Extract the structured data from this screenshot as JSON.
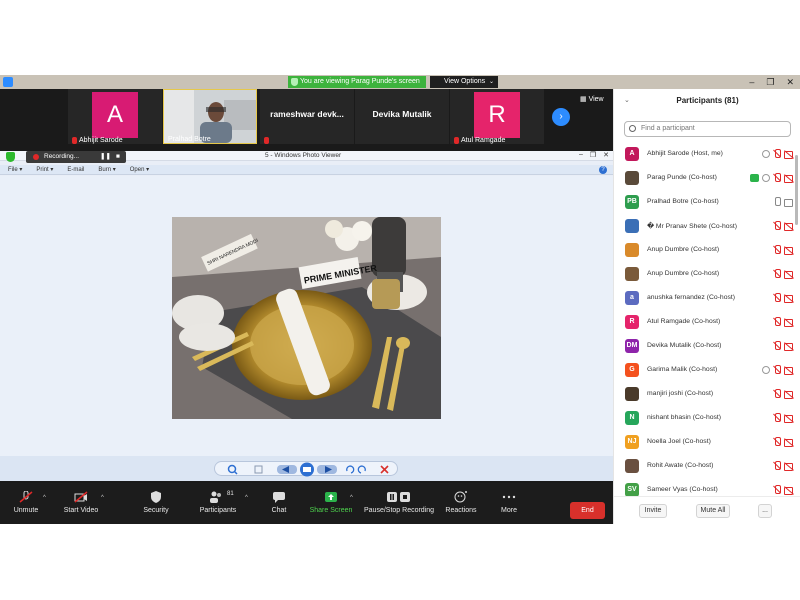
{
  "banner": {
    "viewing": "You are viewing Parag Punde's screen",
    "view_options": "View Options"
  },
  "window_controls": [
    "–",
    "❐",
    "✕"
  ],
  "video_strip": {
    "tiles": [
      {
        "kind": "avatar",
        "initial": "A",
        "color": "#d81b73",
        "name": "Abhijit Sarode",
        "muted": true
      },
      {
        "kind": "video",
        "name": "Pralhad Botre",
        "muted": false
      },
      {
        "kind": "text",
        "big": "rameshwar  devk...",
        "muted": true
      },
      {
        "kind": "text",
        "big": "Devika Mutalik",
        "muted": false
      },
      {
        "kind": "avatar",
        "initial": "R",
        "color": "#e5246b",
        "name": "Atul Ramgade",
        "muted": true
      }
    ],
    "view_label": "View"
  },
  "recording": {
    "label": "Recording...",
    "pause": "❚❚",
    "stop": "■"
  },
  "photo_viewer": {
    "title": "5 - Windows Photo Viewer",
    "menu": [
      "File ▾",
      "Print ▾",
      "E-mail",
      "Burn ▾",
      "Open ▾"
    ],
    "help": "?",
    "photo_card": "PRIME MINISTER",
    "name_card": "SHRI NARENDRA MODI"
  },
  "toolbar": {
    "unmute": "Unmute",
    "start_video": "Start Video",
    "security": "Security",
    "participants": "Participants",
    "participants_count": "81",
    "chat": "Chat",
    "share_screen": "Share Screen",
    "pause_recording": "Pause/Stop Recording",
    "reactions": "Reactions",
    "more": "More",
    "end": "End"
  },
  "panel": {
    "title": "Participants (81)",
    "search_placeholder": "Find a participant",
    "participants": [
      {
        "initials": "A",
        "color": "#c2185b",
        "name": "Abhijit Sarode (Host, me)",
        "icons": [
          "rec",
          "mic-off",
          "cam-off"
        ]
      },
      {
        "initials": "",
        "color": "#5a4a3a",
        "name": "Parag Punde (Co-host)",
        "icons": [
          "share",
          "rec",
          "mic-off",
          "cam-off"
        ]
      },
      {
        "initials": "PB",
        "color": "#2e9d4e",
        "name": "Pralhad Botre (Co-host)",
        "icons": [
          "mic",
          "cam"
        ]
      },
      {
        "initials": "",
        "color": "#3b6fb6",
        "name": "� Mr Pranav Shete (Co-host)",
        "icons": [
          "mic-off",
          "cam-off"
        ]
      },
      {
        "initials": "",
        "color": "#d98a2b",
        "name": "Anup Dumbre (Co-host)",
        "icons": [
          "mic-off",
          "cam-off"
        ]
      },
      {
        "initials": "",
        "color": "#7a5a3a",
        "name": "Anup Dumbre (Co-host)",
        "icons": [
          "mic-off",
          "cam-off"
        ]
      },
      {
        "initials": "a",
        "color": "#5c6bc0",
        "name": "anushka fernandez (Co-host)",
        "icons": [
          "mic-off",
          "cam-off"
        ]
      },
      {
        "initials": "R",
        "color": "#e5246b",
        "name": "Atul Ramgade (Co-host)",
        "icons": [
          "mic-off",
          "cam-off"
        ]
      },
      {
        "initials": "DM",
        "color": "#8e24aa",
        "name": "Devika Mutalik (Co-host)",
        "icons": [
          "mic-off",
          "cam-off"
        ]
      },
      {
        "initials": "G",
        "color": "#f4511e",
        "name": "Garima Malik (Co-host)",
        "icons": [
          "rec",
          "mic-off",
          "cam-off"
        ]
      },
      {
        "initials": "",
        "color": "#4a3a2a",
        "name": "manjiri joshi (Co-host)",
        "icons": [
          "mic-off",
          "cam-off"
        ]
      },
      {
        "initials": "N",
        "color": "#26a65b",
        "name": "nishant bhasin (Co-host)",
        "icons": [
          "mic-off",
          "cam-off"
        ]
      },
      {
        "initials": "NJ",
        "color": "#f0a020",
        "name": "Noella Joel (Co-host)",
        "icons": [
          "mic-off",
          "cam-off"
        ]
      },
      {
        "initials": "",
        "color": "#6a5040",
        "name": "Rohit Awate (Co-host)",
        "icons": [
          "mic-off",
          "cam-off"
        ]
      },
      {
        "initials": "SV",
        "color": "#43a047",
        "name": "Sameer Vyas (Co-host)",
        "icons": [
          "mic-off",
          "cam-off"
        ]
      }
    ],
    "invite": "Invite",
    "mute_all": "Mute All",
    "more": "..."
  }
}
